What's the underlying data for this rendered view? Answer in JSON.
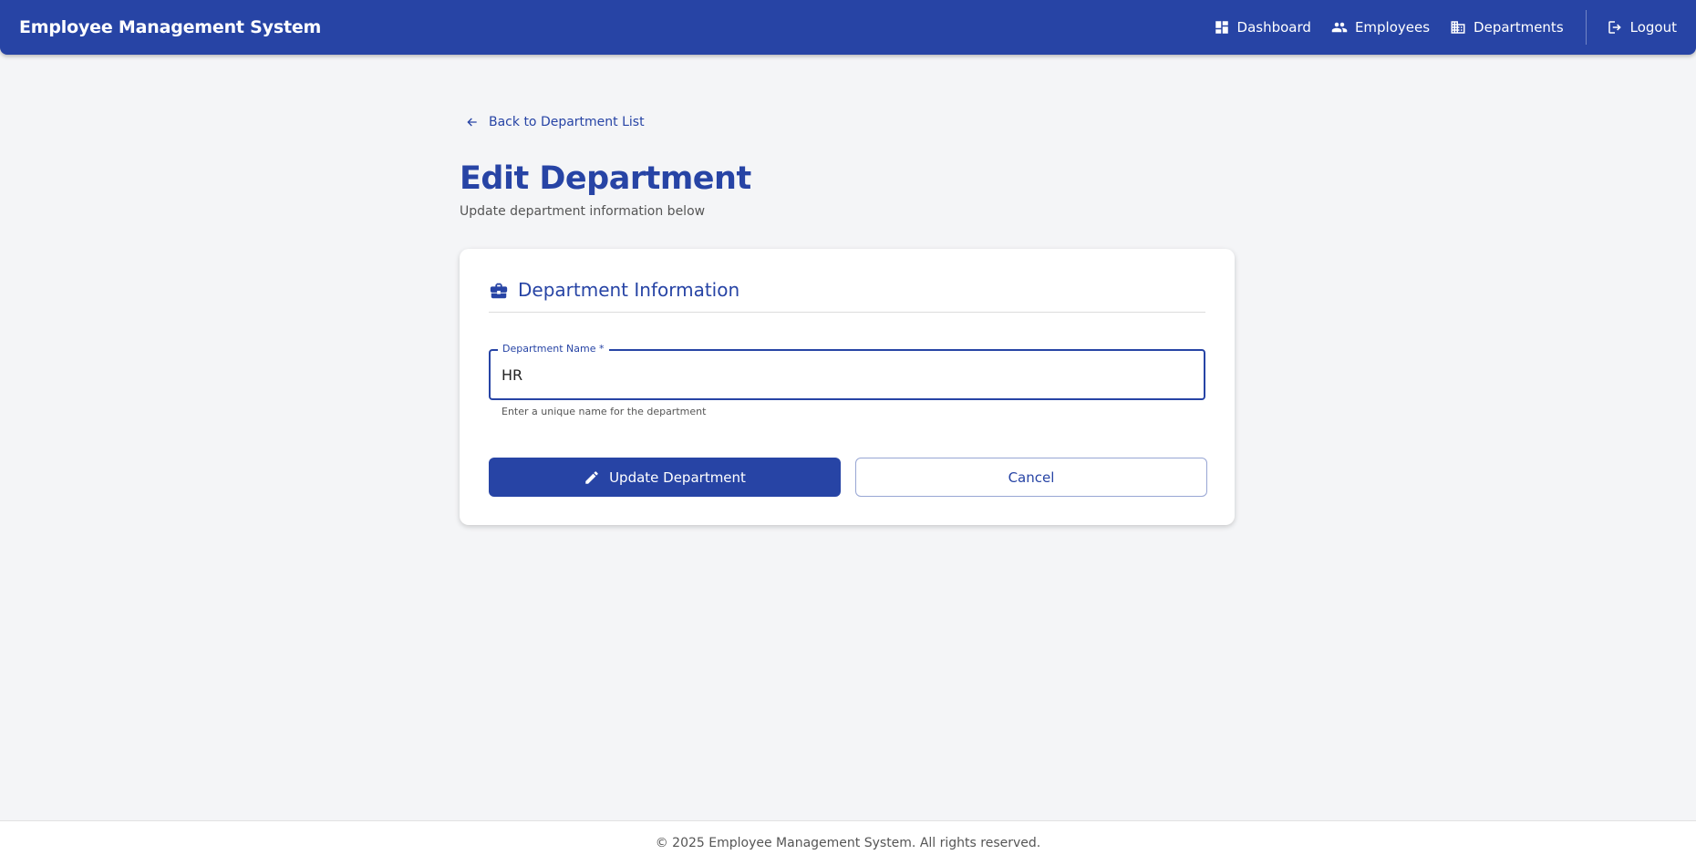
{
  "header": {
    "title": "Employee Management System",
    "nav": [
      {
        "label": "Dashboard",
        "icon": "dashboard-icon"
      },
      {
        "label": "Employees",
        "icon": "people-icon"
      },
      {
        "label": "Departments",
        "icon": "building-icon"
      }
    ],
    "logout": {
      "label": "Logout",
      "icon": "logout-icon"
    }
  },
  "page": {
    "back_label": "Back to Department List",
    "title": "Edit Department",
    "subtitle": "Update department information below"
  },
  "card": {
    "title": "Department Information",
    "icon": "briefcase-icon",
    "field": {
      "label": "Department Name *",
      "value": "HR",
      "helper": "Enter a unique name for the department"
    },
    "update_label": "Update Department",
    "cancel_label": "Cancel"
  },
  "footer": {
    "text": "© 2025 Employee Management System. All rights reserved."
  },
  "colors": {
    "primary": "#2744a5",
    "background": "#f4f5f7"
  }
}
